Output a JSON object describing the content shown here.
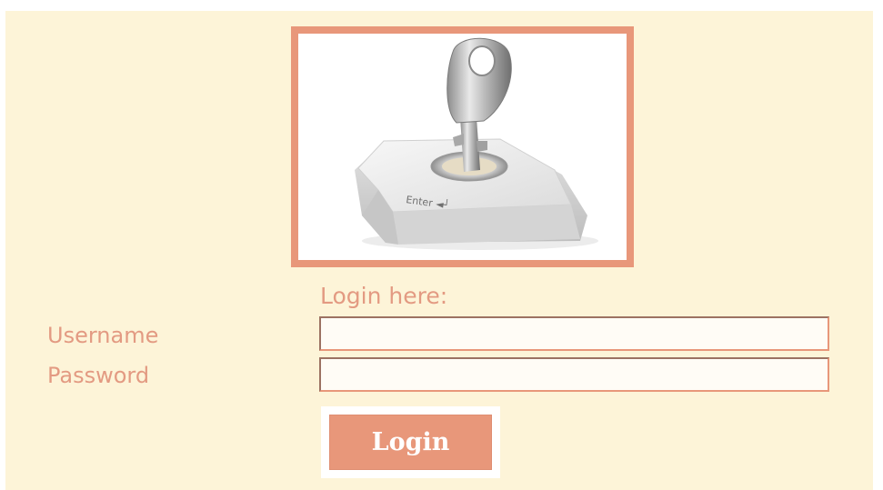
{
  "login": {
    "heading": "Login here:",
    "username_label": "Username",
    "password_label": "Password",
    "username_value": "",
    "password_value": "",
    "button_label": "Login"
  },
  "illustration": {
    "icon": "key-in-enter-key-icon",
    "key_text": "Enter"
  },
  "colors": {
    "panel_background": "#fdf4d8",
    "accent": "#e8977a",
    "label_text": "#e39a82",
    "button_text": "#ffffff"
  }
}
